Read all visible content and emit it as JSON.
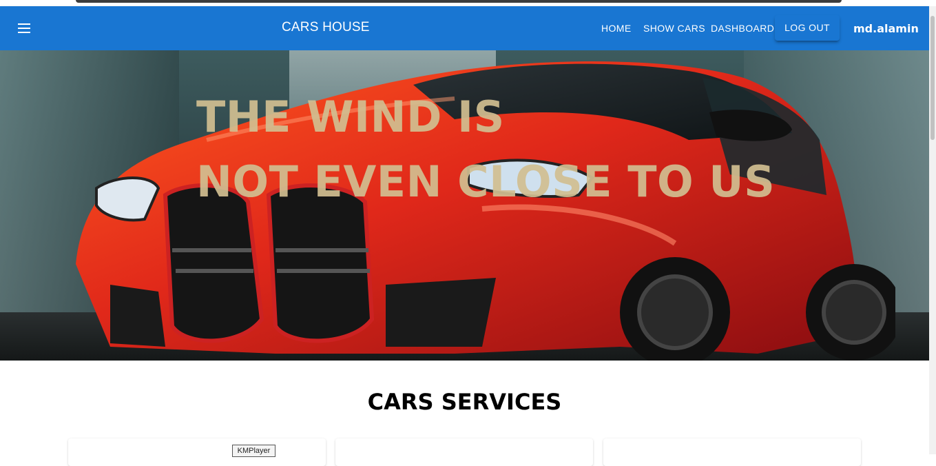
{
  "appbar": {
    "brand": "CARS HOUSE",
    "nav": {
      "home": "HOME",
      "show_cars": "SHOW CARS",
      "dashboard": "DASHBOARD"
    },
    "logout_label": "LOG OUT",
    "username": "md.alamin",
    "color": "#1976d2"
  },
  "hero": {
    "line1": "THE WIND IS",
    "line2": "NOT EVEN CLOSE TO US",
    "text_color": "#d2bf91"
  },
  "services": {
    "title": "CARS SERVICES"
  },
  "overlay": {
    "kmplayer_label": "KMPlayer"
  },
  "icons": {
    "menu": "menu-icon"
  }
}
